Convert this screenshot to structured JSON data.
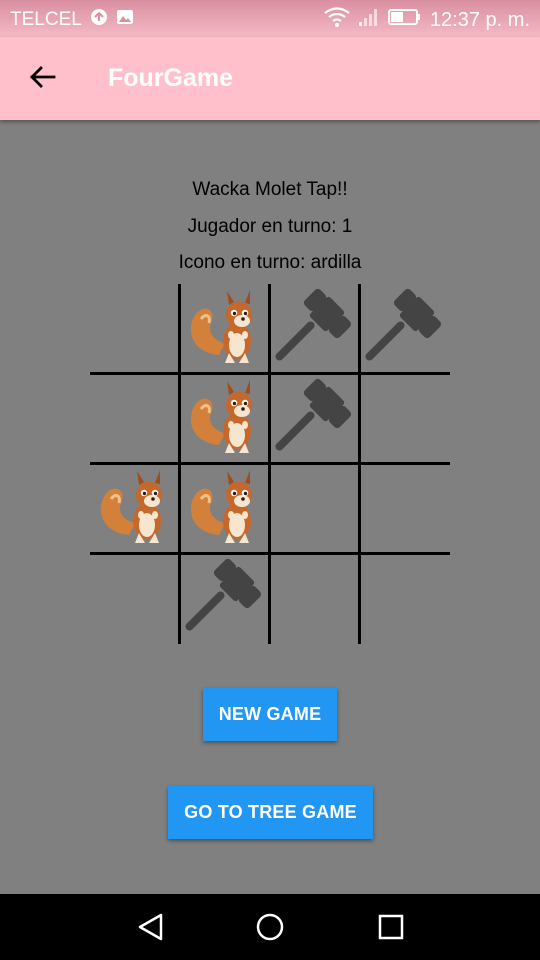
{
  "status_bar": {
    "carrier": "TELCEL",
    "time": "12:37 p. m.",
    "icons": [
      "sync-icon",
      "image-notification-icon",
      "wifi-icon",
      "signal-icon",
      "battery-icon"
    ]
  },
  "app_bar": {
    "title": "FourGame",
    "back_icon": "arrow-left-icon",
    "background": "#ffc0cb"
  },
  "game": {
    "title": "Wacka Molet Tap!!",
    "player_turn": "Jugador en turno: 1",
    "icon_turn": "Icono en turno: ardilla",
    "board": [
      [
        "empty",
        "squirrel",
        "hammer",
        "hammer"
      ],
      [
        "empty",
        "squirrel",
        "hammer",
        "empty"
      ],
      [
        "squirrel",
        "squirrel",
        "empty",
        "empty"
      ],
      [
        "empty",
        "hammer",
        "empty",
        "empty"
      ]
    ]
  },
  "buttons": {
    "new_game": "NEW GAME",
    "tree_game": "GO TO TREE GAME",
    "color": "#2196f3"
  },
  "nav_bar": {
    "icons": [
      "back-triangle-icon",
      "home-circle-icon",
      "recents-square-icon"
    ]
  }
}
